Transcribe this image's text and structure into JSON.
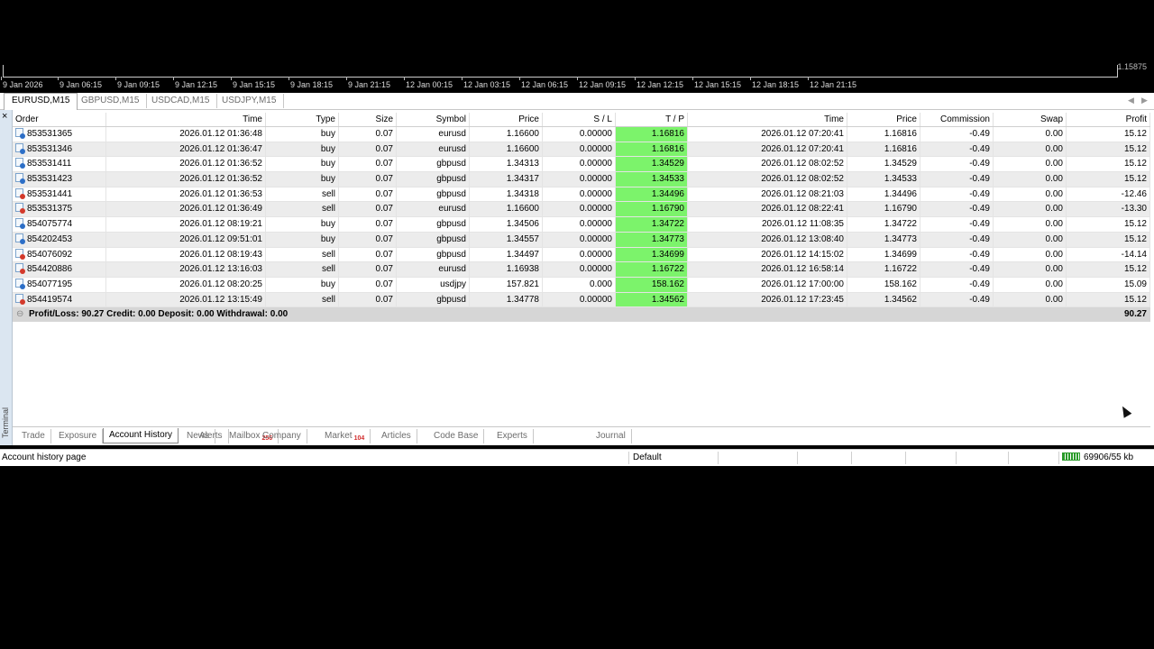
{
  "chart": {
    "price_label": "1.15875",
    "time_ticks": [
      "9 Jan 2026",
      "9 Jan 06:15",
      "9 Jan 09:15",
      "9 Jan 12:15",
      "9 Jan 15:15",
      "9 Jan 18:15",
      "9 Jan 21:15",
      "12 Jan 00:15",
      "12 Jan 03:15",
      "12 Jan 06:15",
      "12 Jan 09:15",
      "12 Jan 12:15",
      "12 Jan 15:15",
      "12 Jan 18:15",
      "12 Jan 21:15"
    ]
  },
  "symbol_tabs": [
    "EURUSD,M15",
    "GBPUSD,M15",
    "USDCAD,M15",
    "USDJPY,M15"
  ],
  "terminal": {
    "side_label": "Terminal",
    "close_glyph": "×",
    "columns": [
      "Order",
      "Time",
      "Type",
      "Size",
      "Symbol",
      "Price",
      "S / L",
      "T / P",
      "Time",
      "Price",
      "Commission",
      "Swap",
      "Profit"
    ],
    "rows": [
      {
        "order": "853531365",
        "open_time": "2026.01.12 01:36:48",
        "type": "buy",
        "size": "0.07",
        "symbol": "eurusd",
        "open_price": "1.16600",
        "sl": "0.00000",
        "tp": "1.16816",
        "close_time": "2026.01.12 07:20:41",
        "close_price": "1.16816",
        "commission": "-0.49",
        "swap": "0.00",
        "profit": "15.12"
      },
      {
        "order": "853531346",
        "open_time": "2026.01.12 01:36:47",
        "type": "buy",
        "size": "0.07",
        "symbol": "eurusd",
        "open_price": "1.16600",
        "sl": "0.00000",
        "tp": "1.16816",
        "close_time": "2026.01.12 07:20:41",
        "close_price": "1.16816",
        "commission": "-0.49",
        "swap": "0.00",
        "profit": "15.12"
      },
      {
        "order": "853531411",
        "open_time": "2026.01.12 01:36:52",
        "type": "buy",
        "size": "0.07",
        "symbol": "gbpusd",
        "open_price": "1.34313",
        "sl": "0.00000",
        "tp": "1.34529",
        "close_time": "2026.01.12 08:02:52",
        "close_price": "1.34529",
        "commission": "-0.49",
        "swap": "0.00",
        "profit": "15.12"
      },
      {
        "order": "853531423",
        "open_time": "2026.01.12 01:36:52",
        "type": "buy",
        "size": "0.07",
        "symbol": "gbpusd",
        "open_price": "1.34317",
        "sl": "0.00000",
        "tp": "1.34533",
        "close_time": "2026.01.12 08:02:52",
        "close_price": "1.34533",
        "commission": "-0.49",
        "swap": "0.00",
        "profit": "15.12"
      },
      {
        "order": "853531441",
        "open_time": "2026.01.12 01:36:53",
        "type": "sell",
        "size": "0.07",
        "symbol": "gbpusd",
        "open_price": "1.34318",
        "sl": "0.00000",
        "tp": "1.34496",
        "close_time": "2026.01.12 08:21:03",
        "close_price": "1.34496",
        "commission": "-0.49",
        "swap": "0.00",
        "profit": "-12.46"
      },
      {
        "order": "853531375",
        "open_time": "2026.01.12 01:36:49",
        "type": "sell",
        "size": "0.07",
        "symbol": "eurusd",
        "open_price": "1.16600",
        "sl": "0.00000",
        "tp": "1.16790",
        "close_time": "2026.01.12 08:22:41",
        "close_price": "1.16790",
        "commission": "-0.49",
        "swap": "0.00",
        "profit": "-13.30"
      },
      {
        "order": "854075774",
        "open_time": "2026.01.12 08:19:21",
        "type": "buy",
        "size": "0.07",
        "symbol": "gbpusd",
        "open_price": "1.34506",
        "sl": "0.00000",
        "tp": "1.34722",
        "close_time": "2026.01.12 11:08:35",
        "close_price": "1.34722",
        "commission": "-0.49",
        "swap": "0.00",
        "profit": "15.12"
      },
      {
        "order": "854202453",
        "open_time": "2026.01.12 09:51:01",
        "type": "buy",
        "size": "0.07",
        "symbol": "gbpusd",
        "open_price": "1.34557",
        "sl": "0.00000",
        "tp": "1.34773",
        "close_time": "2026.01.12 13:08:40",
        "close_price": "1.34773",
        "commission": "-0.49",
        "swap": "0.00",
        "profit": "15.12"
      },
      {
        "order": "854076092",
        "open_time": "2026.01.12 08:19:43",
        "type": "sell",
        "size": "0.07",
        "symbol": "gbpusd",
        "open_price": "1.34497",
        "sl": "0.00000",
        "tp": "1.34699",
        "close_time": "2026.01.12 14:15:02",
        "close_price": "1.34699",
        "commission": "-0.49",
        "swap": "0.00",
        "profit": "-14.14"
      },
      {
        "order": "854420886",
        "open_time": "2026.01.12 13:16:03",
        "type": "sell",
        "size": "0.07",
        "symbol": "eurusd",
        "open_price": "1.16938",
        "sl": "0.00000",
        "tp": "1.16722",
        "close_time": "2026.01.12 16:58:14",
        "close_price": "1.16722",
        "commission": "-0.49",
        "swap": "0.00",
        "profit": "15.12"
      },
      {
        "order": "854077195",
        "open_time": "2026.01.12 08:20:25",
        "type": "buy",
        "size": "0.07",
        "symbol": "usdjpy",
        "open_price": "157.821",
        "sl": "0.000",
        "tp": "158.162",
        "close_time": "2026.01.12 17:00:00",
        "close_price": "158.162",
        "commission": "-0.49",
        "swap": "0.00",
        "profit": "15.09"
      },
      {
        "order": "854419574",
        "open_time": "2026.01.12 13:15:49",
        "type": "sell",
        "size": "0.07",
        "symbol": "gbpusd",
        "open_price": "1.34778",
        "sl": "0.00000",
        "tp": "1.34562",
        "close_time": "2026.01.12 17:23:45",
        "close_price": "1.34562",
        "commission": "-0.49",
        "swap": "0.00",
        "profit": "15.12"
      }
    ],
    "summary": {
      "text": "Profit/Loss: 90.27   Credit: 0.00   Deposit: 0.00   Withdrawal: 0.00",
      "total": "90.27"
    },
    "tabs": [
      {
        "label": "Trade"
      },
      {
        "label": "Exposure"
      },
      {
        "label": "Account History",
        "active": true
      },
      {
        "label": "News"
      },
      {
        "label": "Alerts"
      },
      {
        "label": "Mailbox",
        "badge": "256"
      },
      {
        "label": "Company"
      },
      {
        "label": "Market",
        "badge": "104"
      },
      {
        "label": "Articles"
      },
      {
        "label": "Code Base"
      },
      {
        "label": "Experts"
      },
      {
        "label": "Journal"
      }
    ]
  },
  "status_bar": {
    "message": "Account history page",
    "profile": "Default",
    "traffic": "69906/55 kb"
  },
  "colors": {
    "tp_highlight": "#7cf36b",
    "summary_bg": "#d6d6d6",
    "badge": "#d12b2b"
  }
}
